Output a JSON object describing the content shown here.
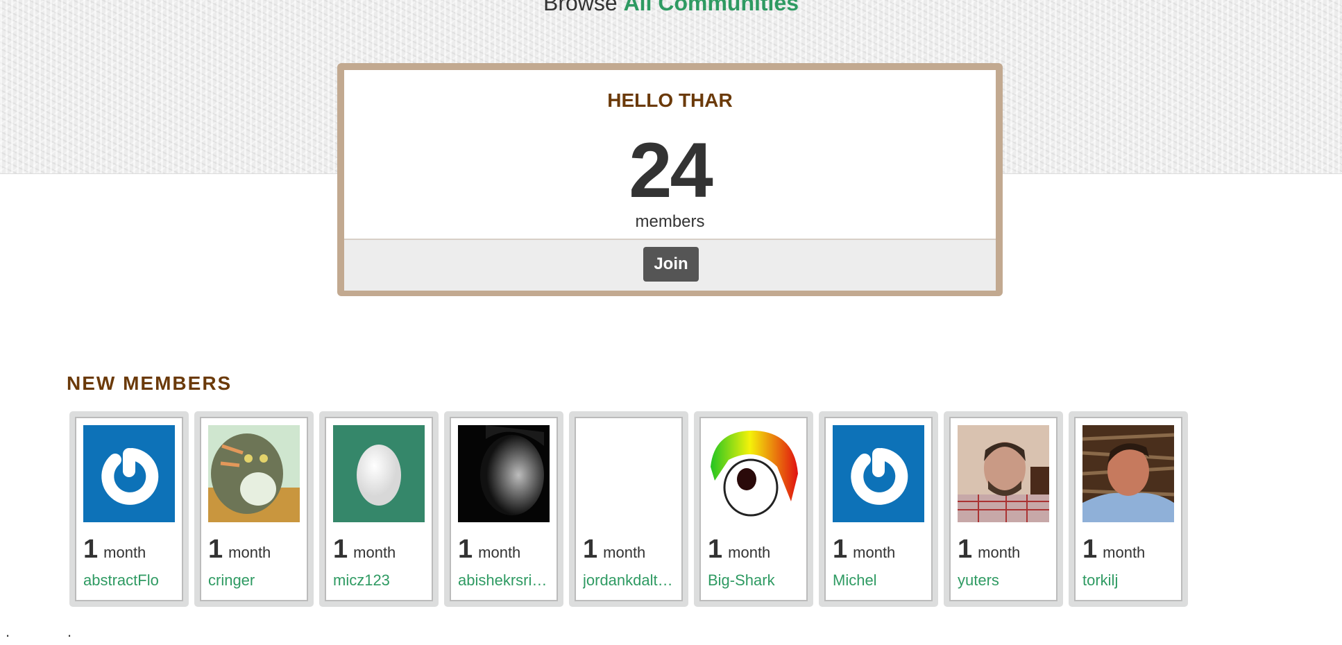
{
  "header": {
    "browse_prefix": "Browse",
    "browse_link": "All Communities"
  },
  "community": {
    "name": "HELLO THAR",
    "member_count": "24",
    "member_label": "members",
    "join_label": "Join"
  },
  "new_members": {
    "title": "NEW MEMBERS",
    "items": [
      {
        "tenure_num": "1",
        "tenure_unit": "month",
        "name": "abstractFlo",
        "avatar": "power-logo-avatar"
      },
      {
        "tenure_num": "1",
        "tenure_unit": "month",
        "name": "cringer",
        "avatar": "cartoon-tiger-avatar"
      },
      {
        "tenure_num": "1",
        "tenure_unit": "month",
        "name": "micz123",
        "avatar": "egg-avatar"
      },
      {
        "tenure_num": "1",
        "tenure_unit": "month",
        "name": "abishekrsri…",
        "avatar": "bw-portrait-avatar"
      },
      {
        "tenure_num": "1",
        "tenure_unit": "month",
        "name": "jordankdalt…",
        "avatar": "blank-avatar"
      },
      {
        "tenure_num": "1",
        "tenure_unit": "month",
        "name": "Big-Shark",
        "avatar": "mohawk-skull-avatar"
      },
      {
        "tenure_num": "1",
        "tenure_unit": "month",
        "name": "Michel",
        "avatar": "power-logo-avatar"
      },
      {
        "tenure_num": "1",
        "tenure_unit": "month",
        "name": "yuters",
        "avatar": "webcam-portrait-avatar"
      },
      {
        "tenure_num": "1",
        "tenure_unit": "month",
        "name": "torkilj",
        "avatar": "stone-wall-portrait-avatar"
      }
    ]
  },
  "footer": {
    "dot1": ".",
    "dot2": "."
  },
  "colors": {
    "accent_green": "#2e9a62",
    "heading_brown": "#6b3a0a",
    "button_dark": "#555555"
  }
}
